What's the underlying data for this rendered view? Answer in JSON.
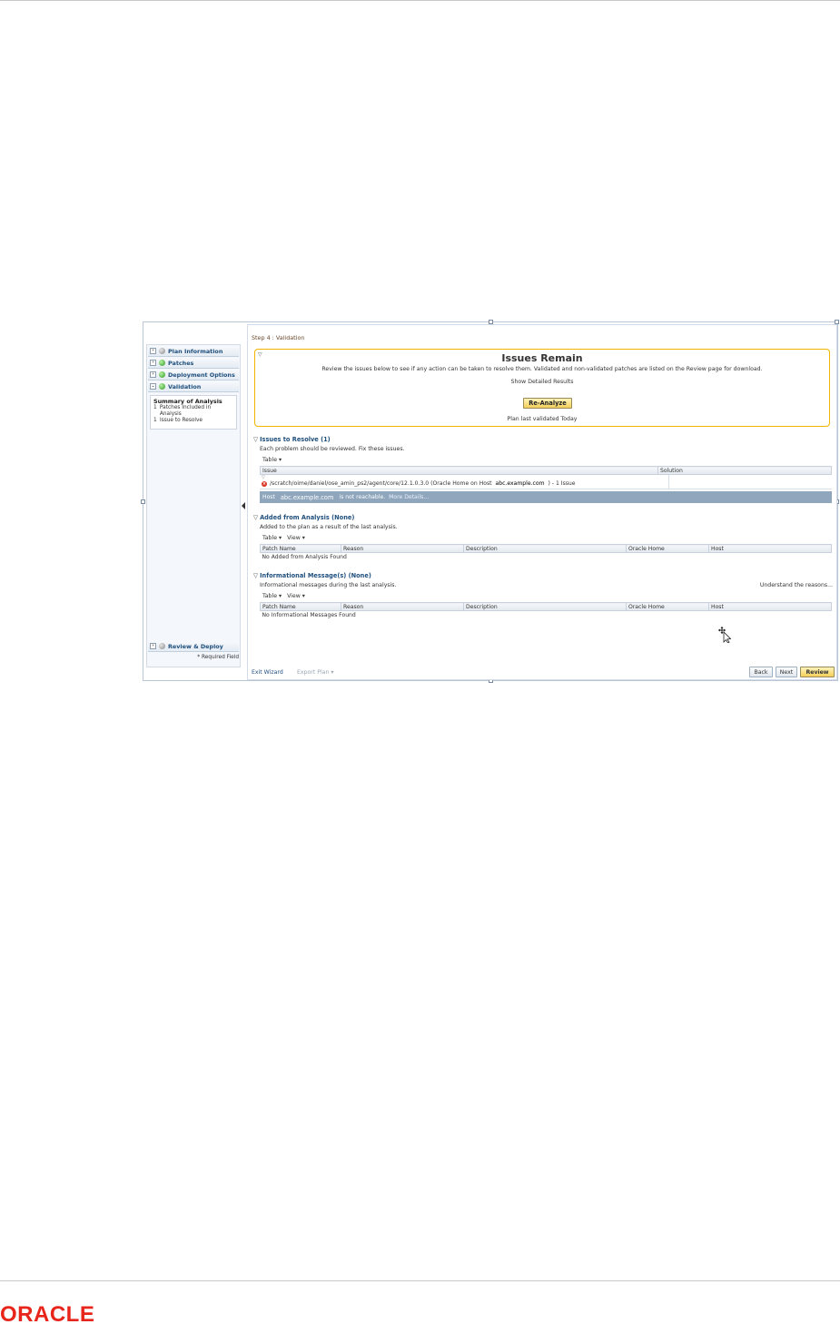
{
  "brand": {
    "logo_text": "ORACLE",
    "logo_color": "#e8251a"
  },
  "nav": {
    "items": [
      {
        "label": "Plan Information",
        "status": "grey"
      },
      {
        "label": "Patches",
        "status": "green"
      },
      {
        "label": "Deployment Options",
        "status": "green"
      },
      {
        "label": "Validation",
        "status": "green"
      }
    ],
    "summary": {
      "title": "Summary of Analysis",
      "rows": [
        {
          "count": "1",
          "label": "Patches Included in Analysis"
        },
        {
          "count": "1",
          "label": "Issue to Resolve"
        }
      ]
    },
    "review_deploy": "Review & Deploy",
    "required_field": "* Required Field"
  },
  "main": {
    "step": "Step 4 : Validation",
    "issues_box": {
      "title": "Issues Remain",
      "description": "Review the issues below to see if any action can be taken to resolve them. Validated and non-validated patches are listed on the Review page for download.",
      "detail_link": "Show Detailed Results",
      "reanalyze": "Re-Analyze",
      "last_validated": "Plan last validated Today"
    },
    "issues_to_resolve": {
      "title": "Issues to Resolve (1)",
      "desc": "Each problem should be reviewed. Fix these issues.",
      "toolbar": {
        "table": "Table ▾"
      },
      "columns": [
        "Issue",
        "Solution"
      ],
      "row": {
        "path": "/scratch/oime/daniel/ose_amin_ps2/agent/core/12.1.0.3.0 (Oracle Home on Host",
        "host": "abc.example.com",
        "suffix": ") - 1 Issue"
      },
      "selected": {
        "prefix": "Host",
        "host": "abc.example.com",
        "message": "is not reachable.",
        "more": "More Details..."
      }
    },
    "added_from_analysis": {
      "title": "Added from Analysis (None)",
      "desc": "Added to the plan as a result of the last analysis.",
      "toolbar": {
        "table": "Table ▾",
        "view": "View ▾"
      },
      "columns": [
        "Patch Name",
        "Reason",
        "Description",
        "Oracle Home",
        "Host"
      ],
      "empty": "No Added from Analysis Found"
    },
    "informational": {
      "title": "Informational Message(s) (None)",
      "desc": "Informational messages during the last analysis.",
      "right_link": "Understand the reasons...",
      "toolbar": {
        "table": "Table ▾",
        "view": "View ▾"
      },
      "columns": [
        "Patch Name",
        "Reason",
        "Description",
        "Oracle Home",
        "Host"
      ],
      "empty": "No Informational Messages Found"
    },
    "footer": {
      "exit": "Exit Wizard",
      "export": "Export Plan ▾",
      "back": "Back",
      "next": "Next",
      "review": "Review"
    }
  }
}
